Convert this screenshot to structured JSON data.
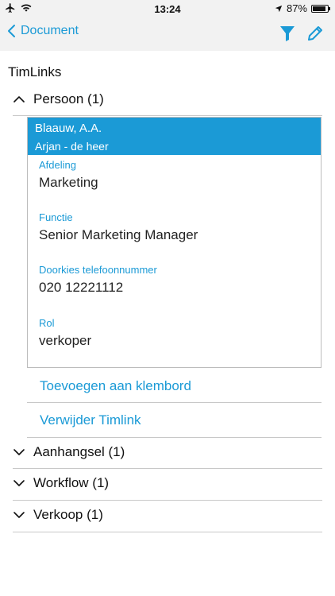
{
  "status": {
    "time": "13:24",
    "battery": "87%",
    "battery_level": 0.87
  },
  "nav": {
    "back_label": "Document",
    "icons": [
      "filter-icon",
      "pencil-icon"
    ]
  },
  "section_title": "TimLinks",
  "groups": [
    {
      "label": "Persoon (1)",
      "expanded": true
    },
    {
      "label": "Aanhangsel (1)",
      "expanded": false
    },
    {
      "label": "Workflow (1)",
      "expanded": false
    },
    {
      "label": "Verkoop (1)",
      "expanded": false
    }
  ],
  "person": {
    "name": "Blaauw, A.A.",
    "subtitle": "Arjan - de heer",
    "fields": [
      {
        "label": "Afdeling",
        "value": "Marketing"
      },
      {
        "label": "Functie",
        "value": "Senior Marketing Manager"
      },
      {
        "label": "Doorkies telefoonnummer",
        "value": "020 12221112"
      },
      {
        "label": "Rol",
        "value": "verkoper"
      }
    ]
  },
  "actions": {
    "add_clipboard": "Toevoegen aan klembord",
    "remove_timlink": "Verwijder Timlink"
  },
  "colors": {
    "accent": "#1b9ad6",
    "bar_bg": "#f2f2f2"
  }
}
